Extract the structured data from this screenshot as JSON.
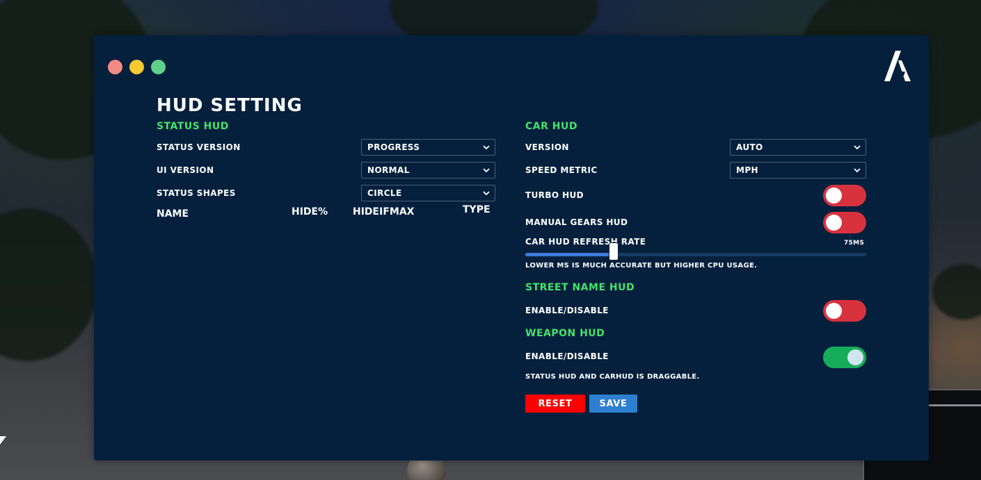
{
  "window": {
    "dots": [
      {
        "name": "close",
        "color": "#f28b84"
      },
      {
        "name": "minimize",
        "color": "#f6c933"
      },
      {
        "name": "maximize",
        "color": "#5fcf8a"
      }
    ],
    "logo_icon": "fivem-logo"
  },
  "title": "HUD SETTING",
  "colors": {
    "panel": "#05203d",
    "section_title": "#45e36b",
    "toggle_off": "#d9323f",
    "toggle_on": "#16ad5a",
    "reset": "#fe0000",
    "save": "#2f7fd0",
    "slider_fill": "#3f7bdc"
  },
  "status_hud": {
    "section_title": "STATUS HUD",
    "rows": [
      {
        "label": "STATUS VERSION",
        "value": "PROGRESS"
      },
      {
        "label": "UI VERSION",
        "value": "NORMAL"
      },
      {
        "label": "STATUS SHAPES",
        "value": "CIRCLE"
      }
    ],
    "columns": [
      "NAME",
      "HIDE%",
      "HIDEIFMAX",
      "TYPE"
    ]
  },
  "car_hud": {
    "section_title": "CAR HUD",
    "version_label": "VERSION",
    "version_value": "AUTO",
    "speed_metric_label": "SPEED METRIC",
    "speed_metric_value": "MPH",
    "turbo_label": "TURBO HUD",
    "turbo_enabled": false,
    "manual_gears_label": "MANUAL GEARS HUD",
    "manual_gears_enabled": false,
    "refresh_rate_label": "CAR HUD REFRESH RATE",
    "refresh_rate_value": "75MS",
    "refresh_rate_fraction": 0.26,
    "refresh_note": "LOWER MS IS MUCH ACCURATE BUT HIGHER CPU USAGE."
  },
  "street_name_hud": {
    "section_title": "STREET NAME HUD",
    "toggle_label": "ENABLE/DISABLE",
    "enabled": false
  },
  "weapon_hud": {
    "section_title": "WEAPON HUD",
    "toggle_label": "ENABLE/DISABLE",
    "enabled": true
  },
  "footer": {
    "note": "STATUS HUD AND CARHUD IS DRAGGABLE.",
    "reset_label": "RESET",
    "save_label": "SAVE"
  }
}
